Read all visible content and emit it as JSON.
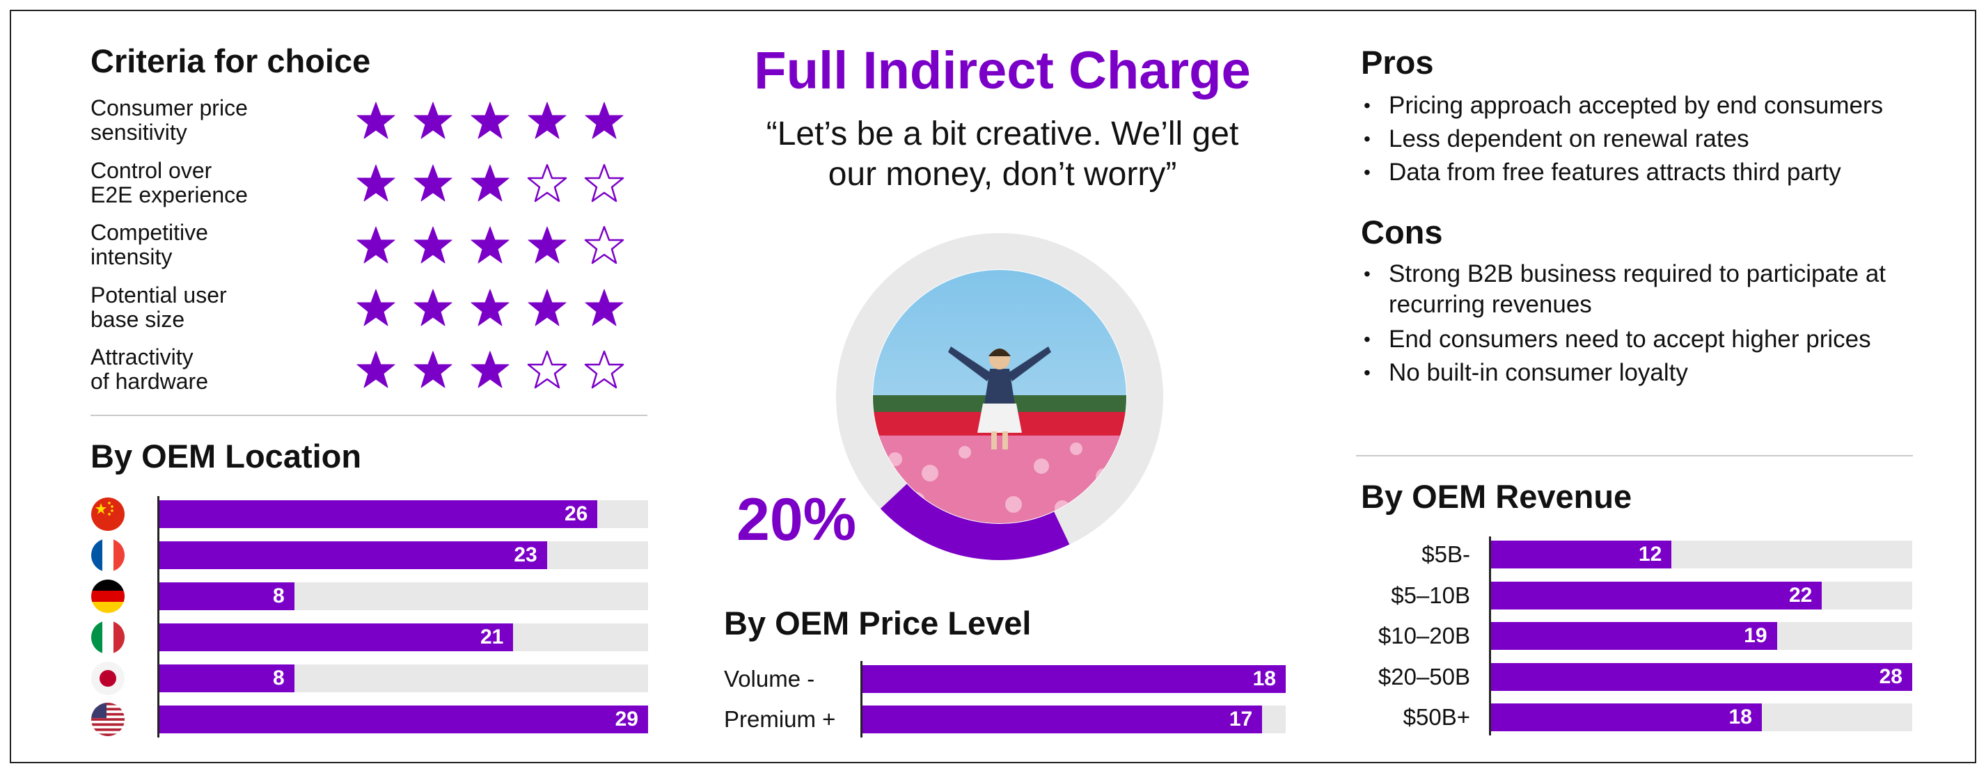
{
  "criteria": {
    "heading": "Criteria for choice",
    "items": [
      {
        "label": "Consumer price\nsensitivity",
        "rating": 5
      },
      {
        "label": "Control over\nE2E experience",
        "rating": 3
      },
      {
        "label": "Competitive\nintensity",
        "rating": 4
      },
      {
        "label": "Potential user\nbase size",
        "rating": 5
      },
      {
        "label": "Attractivity\nof hardware",
        "rating": 3
      }
    ],
    "max_rating": 5
  },
  "model": {
    "title": "Full Indirect Charge",
    "quote": "“Let’s be a bit creative. We’ll get\nour money, don’t worry”",
    "share_label": "20%",
    "share_value": 0.2
  },
  "pros": {
    "heading": "Pros",
    "items": [
      "Pricing approach accepted by end consumers",
      "Less dependent on renewal rates",
      "Data from free features attracts third party"
    ]
  },
  "cons": {
    "heading": "Cons",
    "items": [
      "Strong B2B business required to participate at recurring revenues",
      "End consumers need to accept higher prices",
      "No built-in consumer loyalty"
    ]
  },
  "colors": {
    "accent": "#7b00c7",
    "track": "#e8e8e8",
    "ring": "#e9e9e9"
  },
  "chart_data": [
    {
      "type": "bar",
      "orientation": "horizontal",
      "title": "By OEM Location",
      "categories": [
        "china-flag-icon",
        "france-flag-icon",
        "germany-flag-icon",
        "italy-flag-icon",
        "japan-flag-icon",
        "usa-flag-icon"
      ],
      "values": [
        26,
        23,
        8,
        21,
        8,
        29
      ],
      "xlim": [
        0,
        29
      ]
    },
    {
      "type": "bar",
      "orientation": "horizontal",
      "title": "By OEM Price Level",
      "categories": [
        "Volume -",
        "Premium +"
      ],
      "values": [
        18,
        17
      ],
      "xlim": [
        0,
        18
      ]
    },
    {
      "type": "bar",
      "orientation": "horizontal",
      "title": "By OEM Revenue",
      "categories": [
        "$5B-",
        "$5–10B",
        "$10–20B",
        "$20–50B",
        "$50B+"
      ],
      "values": [
        12,
        22,
        19,
        28,
        18
      ],
      "xlim": [
        0,
        28
      ]
    }
  ]
}
